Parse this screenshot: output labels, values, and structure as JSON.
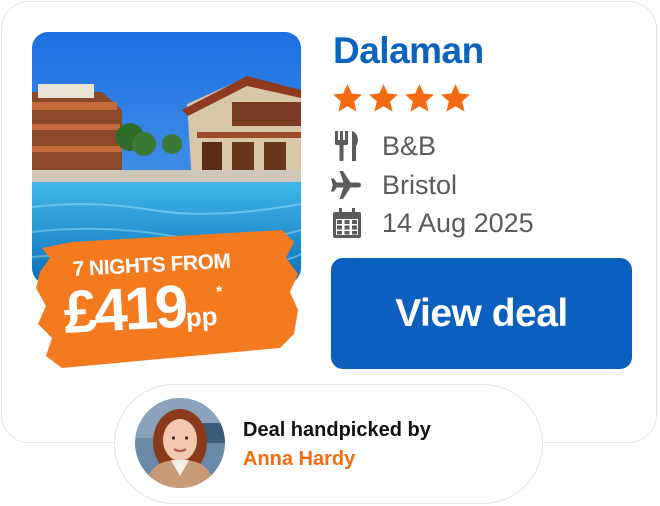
{
  "deal": {
    "destination": "Dalaman",
    "star_rating": 4,
    "board": "B&B",
    "departure_airport": "Bristol",
    "date": "14 Aug 2025",
    "price_prefix": "7 NIGHTS FROM",
    "price": "£419",
    "price_suffix": "pp",
    "price_footnote_marker": "*",
    "cta_label": "View deal"
  },
  "agent": {
    "label": "Deal handpicked by",
    "name": "Anna Hardy"
  },
  "icons": {
    "board": "cutlery-icon",
    "airport": "plane-icon",
    "date": "calendar-icon",
    "rating": "star-icon"
  },
  "colors": {
    "brand_blue": "#0a63bf",
    "cta_blue": "#0a5fbf",
    "tag_orange": "#f47a1f",
    "star_orange": "#f26b12",
    "agent_name_orange": "#f26b12"
  }
}
